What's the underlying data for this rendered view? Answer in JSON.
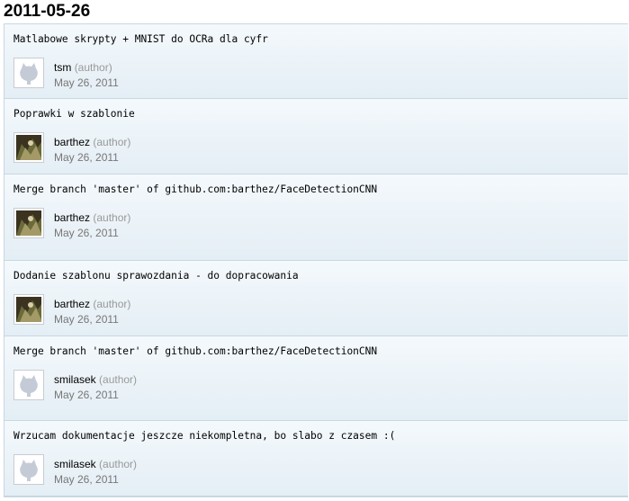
{
  "date": "2011-05-26",
  "author_role": "(author)",
  "commits": [
    {
      "message": "Matlabowe skrypty + MNIST do OCRa dla cyfr",
      "author": "tsm",
      "date": "May 26, 2011",
      "avatar": "octocat-placeholder-icon"
    },
    {
      "message": "Poprawki w szablonie",
      "author": "barthez",
      "date": "May 26, 2011",
      "avatar": "user-photo-avatar"
    },
    {
      "message": "Merge branch 'master' of github.com:barthez/FaceDetectionCNN",
      "author": "barthez",
      "date": "May 26, 2011",
      "avatar": "user-photo-avatar"
    },
    {
      "message": "Dodanie szablonu sprawozdania - do dopracowania",
      "author": "barthez",
      "date": "May 26, 2011",
      "avatar": "user-photo-avatar"
    },
    {
      "message": "Merge branch 'master' of github.com:barthez/FaceDetectionCNN",
      "author": "smilasek",
      "date": "May 26, 2011",
      "avatar": "octocat-placeholder-icon"
    },
    {
      "message": "Wrzucam dokumentacje jeszcze niekompletna, bo slabo z czasem :(",
      "author": "smilasek",
      "date": "May 26, 2011",
      "avatar": "octocat-placeholder-icon"
    }
  ]
}
